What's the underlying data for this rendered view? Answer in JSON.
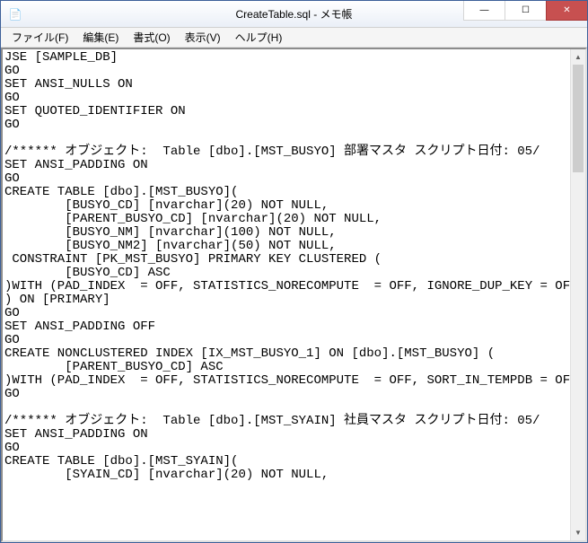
{
  "window": {
    "title": "CreateTable.sql - メモ帳"
  },
  "menu": {
    "file": "ファイル(F)",
    "edit": "編集(E)",
    "format": "書式(O)",
    "view": "表示(V)",
    "help": "ヘルプ(H)"
  },
  "icons": {
    "app": "📄",
    "minimize": "—",
    "maximize": "☐",
    "close": "✕",
    "arrow_up": "▲",
    "arrow_down": "▼"
  },
  "editor": {
    "content": "JSE [SAMPLE_DB]\nGO\nSET ANSI_NULLS ON\nGO\nSET QUOTED_IDENTIFIER ON\nGO\n\n/****** オブジェクト:  Table [dbo].[MST_BUSYO] 部署マスタ スクリプト日付: 05/\nSET ANSI_PADDING ON\nGO\nCREATE TABLE [dbo].[MST_BUSYO](\n        [BUSYO_CD] [nvarchar](20) NOT NULL,\n        [PARENT_BUSYO_CD] [nvarchar](20) NOT NULL,\n        [BUSYO_NM] [nvarchar](100) NOT NULL,\n        [BUSYO_NM2] [nvarchar](50) NOT NULL,\n CONSTRAINT [PK_MST_BUSYO] PRIMARY KEY CLUSTERED (\n        [BUSYO_CD] ASC\n)WITH (PAD_INDEX  = OFF, STATISTICS_NORECOMPUTE  = OFF, IGNORE_DUP_KEY = OFF,\n) ON [PRIMARY]\nGO\nSET ANSI_PADDING OFF\nGO\nCREATE NONCLUSTERED INDEX [IX_MST_BUSYO_1] ON [dbo].[MST_BUSYO] (\n        [PARENT_BUSYO_CD] ASC\n)WITH (PAD_INDEX  = OFF, STATISTICS_NORECOMPUTE  = OFF, SORT_IN_TEMPDB = OFF,\nGO\n\n/****** オブジェクト:  Table [dbo].[MST_SYAIN] 社員マスタ スクリプト日付: 05/\nSET ANSI_PADDING ON\nGO\nCREATE TABLE [dbo].[MST_SYAIN](\n        [SYAIN_CD] [nvarchar](20) NOT NULL,"
  }
}
